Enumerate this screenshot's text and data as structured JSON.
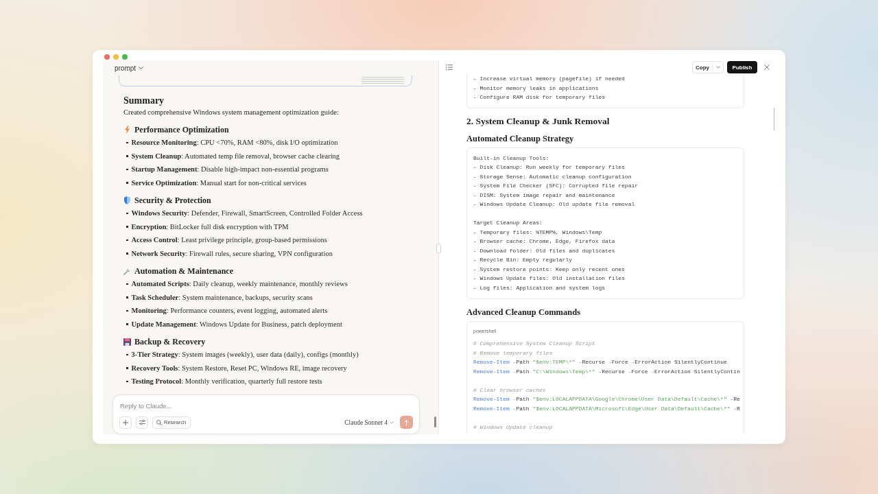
{
  "chat": {
    "header": {
      "label": "prompt"
    },
    "summary": {
      "title": "Summary",
      "intro": "Created comprehensive Windows system management optimization guide:"
    },
    "sections": [
      {
        "title": "Performance Optimization",
        "items": [
          "**Resource Monitoring**: CPU <70%, RAM <80%, disk I/O optimization",
          "**System Cleanup**: Automated temp file removal, browser cache clearing",
          "**Startup Management**: Disable high-impact non-essential programs",
          "**Service Optimization**: Manual start for non-critical services"
        ]
      },
      {
        "title": "Security & Protection",
        "items": [
          "**Windows Security**: Defender, Firewall, SmartScreen, Controlled Folder Access",
          "**Encryption**: BitLocker full disk encryption with TPM",
          "**Access Control**: Least privilege principle, group-based permissions",
          "**Network Security**: Firewall rules, secure sharing, VPN configuration"
        ]
      },
      {
        "title": "Automation & Maintenance",
        "items": [
          "**Automated Scripts**: Daily cleanup, weekly maintenance, monthly reviews",
          "**Task Scheduler**: System maintenance, backups, security scans",
          "**Monitoring**: Performance counters, event logging, automated alerts",
          "**Update Management**: Windows Update for Business, patch deployment"
        ]
      },
      {
        "title": "Backup & Recovery",
        "items": [
          "**3-Tier Strategy**: System images (weekly), user data (daily), configs (monthly)",
          "**Recovery Tools**: System Restore, Reset PC, Windows RE, image recovery",
          "**Testing Protocol**: Monthly verification, quarterly full restore tests"
        ]
      }
    ],
    "composer": {
      "placeholder": "Reply to Claude...",
      "research_label": "Research",
      "model": "Claude Sonnet 4",
      "send_button": {
        "disabled": true
      }
    }
  },
  "artifact": {
    "toolbar": {
      "copy_label": "Copy",
      "publish_label": "Publish"
    },
    "content": [
      {
        "kind": "code",
        "groups": [
          [
            "- Increase virtual memory (pagefile) if needed",
            "- Monitor memory leaks in applications",
            "- Configure RAM disk for temporary files"
          ]
        ]
      },
      {
        "kind": "heading",
        "text": "2. System Cleanup & Junk Removal"
      },
      {
        "kind": "subheading",
        "text": "Automated Cleanup Strategy"
      },
      {
        "kind": "code",
        "groups": [
          [
            "Built-in Cleanup Tools:",
            "- Disk Cleanup: Run weekly for temporary files",
            "- Storage Sense: Automatic cleanup configuration",
            "- System File Checker (SFC): Corrupted file repair",
            "- DISM: System image repair and maintenance",
            "- Windows Update Cleanup: Old update file removal"
          ],
          [
            "Target Cleanup Areas:",
            "- Temporary files: %TEMP%, Windows\\Temp",
            "- Browser cache: Chrome, Edge, Firefox data",
            "- Download folder: Old files and duplicates",
            "- Recycle Bin: Empty regularly",
            "- System restore points: Keep only recent ones",
            "- Windows Update files: Old installation files",
            "- Log files: Application and system logs"
          ]
        ]
      },
      {
        "kind": "subheading",
        "text": "Advanced Cleanup Commands"
      },
      {
        "kind": "highlighted_code",
        "language": "powershell",
        "groups": [
          [
            [
              {
                "kind": "comment",
                "text": "# Comprehensive System Cleanup Script"
              }
            ],
            [
              {
                "kind": "comment",
                "text": "# Remove temporary files"
              }
            ],
            [
              {
                "kind": "command",
                "text": "Remove-Item"
              },
              {
                "kind": "operator",
                "text": " -"
              },
              {
                "kind": "plain",
                "text": "Path "
              },
              {
                "kind": "string",
                "text": "\"$env:TEMP\\*\""
              },
              {
                "kind": "operator",
                "text": " -"
              },
              {
                "kind": "plain",
                "text": "Recurse"
              },
              {
                "kind": "operator",
                "text": " -"
              },
              {
                "kind": "plain",
                "text": "Force"
              },
              {
                "kind": "operator",
                "text": " -"
              },
              {
                "kind": "plain",
                "text": "ErrorAction SilentlyContinue"
              }
            ],
            [
              {
                "kind": "command",
                "text": "Remove-Item"
              },
              {
                "kind": "operator",
                "text": " -"
              },
              {
                "kind": "plain",
                "text": "Path "
              },
              {
                "kind": "string",
                "text": "\"C:\\Windows\\Temp\\*\""
              },
              {
                "kind": "operator",
                "text": " -"
              },
              {
                "kind": "plain",
                "text": "Recurse"
              },
              {
                "kind": "operator",
                "text": " -"
              },
              {
                "kind": "plain",
                "text": "Force"
              },
              {
                "kind": "operator",
                "text": " -"
              },
              {
                "kind": "plain",
                "text": "ErrorAction SilentlyContin"
              }
            ]
          ],
          [
            [
              {
                "kind": "comment",
                "text": "# Clear browser caches"
              }
            ],
            [
              {
                "kind": "command",
                "text": "Remove-Item"
              },
              {
                "kind": "operator",
                "text": " -"
              },
              {
                "kind": "plain",
                "text": "Path "
              },
              {
                "kind": "string",
                "text": "\"$env:LOCALAPPDATA\\Google\\Chrome\\User Data\\Default\\Cache\\*\""
              },
              {
                "kind": "operator",
                "text": " -"
              },
              {
                "kind": "plain",
                "text": "Re"
              }
            ],
            [
              {
                "kind": "command",
                "text": "Remove-Item"
              },
              {
                "kind": "operator",
                "text": " -"
              },
              {
                "kind": "plain",
                "text": "Path "
              },
              {
                "kind": "string",
                "text": "\"$env:LOCALAPPDATA\\Microsoft\\Edge\\User Data\\Default\\Cache\\*\""
              },
              {
                "kind": "operator",
                "text": " -"
              },
              {
                "kind": "plain",
                "text": "R"
              }
            ]
          ],
          [
            [
              {
                "kind": "comment",
                "text": "# Windows Update cleanup"
              }
            ]
          ]
        ]
      }
    ]
  }
}
